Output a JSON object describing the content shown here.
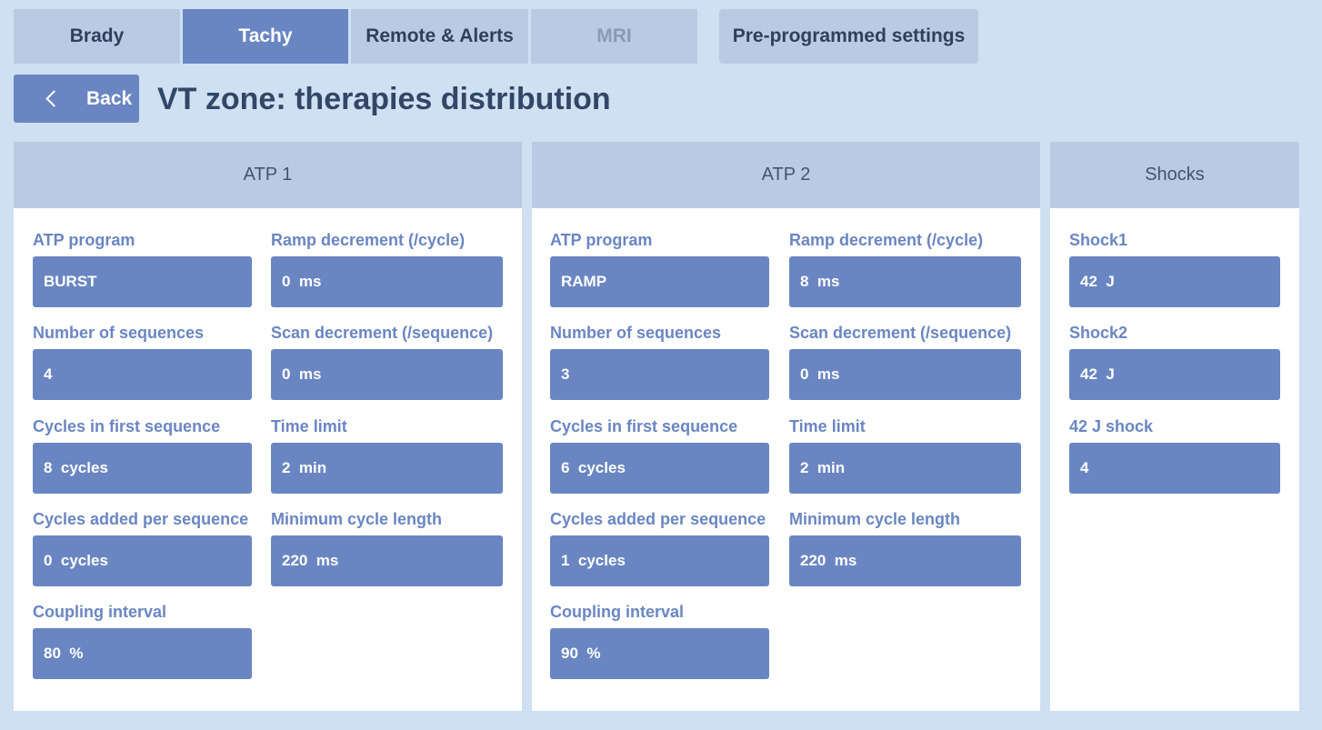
{
  "tabs": [
    {
      "label": "Brady",
      "state": "normal"
    },
    {
      "label": "Tachy",
      "state": "active"
    },
    {
      "label": "Remote & Alerts",
      "state": "normal"
    },
    {
      "label": "MRI",
      "state": "disabled"
    },
    {
      "label": "Pre-programmed settings",
      "state": "normal"
    }
  ],
  "back_label": "Back",
  "page_title": "VT zone: therapies distribution",
  "colors": {
    "background": "#cfe0f3",
    "accent": "#6a86c2",
    "panel_header": "#b9cbe3",
    "title_text": "#324666"
  },
  "panels": {
    "atp1": {
      "title": "ATP 1",
      "fields": {
        "atp_program": {
          "label": "ATP program",
          "value": "BURST"
        },
        "ramp_decrement": {
          "label": "Ramp decrement (/cycle)",
          "value": "0  ms"
        },
        "number_of_sequences": {
          "label": "Number of sequences",
          "value": "4"
        },
        "scan_decrement": {
          "label": "Scan decrement (/sequence)",
          "value": "0  ms"
        },
        "cycles_first_sequence": {
          "label": "Cycles in first sequence",
          "value": "8  cycles"
        },
        "time_limit": {
          "label": "Time limit",
          "value": "2  min"
        },
        "cycles_added": {
          "label": "Cycles added per sequence",
          "value": "0  cycles"
        },
        "min_cycle_length": {
          "label": "Minimum cycle length",
          "value": "220  ms"
        },
        "coupling_interval": {
          "label": "Coupling interval",
          "value": "80  %"
        }
      }
    },
    "atp2": {
      "title": "ATP 2",
      "fields": {
        "atp_program": {
          "label": "ATP program",
          "value": "RAMP"
        },
        "ramp_decrement": {
          "label": "Ramp decrement (/cycle)",
          "value": "8  ms"
        },
        "number_of_sequences": {
          "label": "Number of sequences",
          "value": "3"
        },
        "scan_decrement": {
          "label": "Scan decrement (/sequence)",
          "value": "0  ms"
        },
        "cycles_first_sequence": {
          "label": "Cycles in first sequence",
          "value": "6  cycles"
        },
        "time_limit": {
          "label": "Time limit",
          "value": "2  min"
        },
        "cycles_added": {
          "label": "Cycles added per sequence",
          "value": "1  cycles"
        },
        "min_cycle_length": {
          "label": "Minimum cycle length",
          "value": "220  ms"
        },
        "coupling_interval": {
          "label": "Coupling interval",
          "value": "90  %"
        }
      }
    },
    "shocks": {
      "title": "Shocks",
      "fields": {
        "shock1": {
          "label": "Shock1",
          "value": "42  J"
        },
        "shock2": {
          "label": "Shock2",
          "value": "42  J"
        },
        "shock_42j": {
          "label": "42 J shock",
          "value": "4"
        }
      }
    }
  }
}
